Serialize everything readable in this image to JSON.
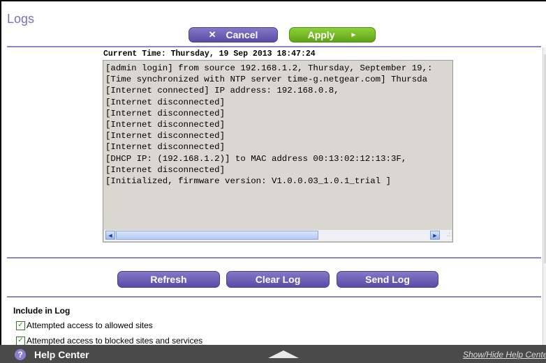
{
  "page": {
    "title": "Logs"
  },
  "toolbar": {
    "cancel_icon": "✕",
    "cancel_label": "Cancel",
    "apply_label": "Apply",
    "apply_arrow": "►"
  },
  "log": {
    "current_time": "Current Time: Thursday, 19 Sep 2013 18:47:24",
    "lines": [
      "[admin login] from source 192.168.1.2, Thursday, September 19,:",
      "[Time synchronized with NTP server time-g.netgear.com] Thursda",
      "[Internet connected] IP address: 192.168.0.8,",
      "[Internet disconnected]",
      "[Internet disconnected]",
      "[Internet disconnected]",
      "[Internet disconnected]",
      "[Internet disconnected]",
      "[DHCP IP: (192.168.1.2)] to MAC address 00:13:02:12:13:3F,",
      "[Internet disconnected]",
      "[Initialized, firmware version: V1.0.0.03_1.0.1_trial ]"
    ],
    "scroll_left_icon": "◄",
    "scroll_right_icon": "►",
    "resize_grip": ".:"
  },
  "actions": {
    "refresh_label": "Refresh",
    "clear_log_label": "Clear Log",
    "send_log_label": "Send Log"
  },
  "include": {
    "heading": "Include in Log",
    "options": [
      {
        "label": "Attempted access to allowed sites",
        "checked": true
      },
      {
        "label": "Attempted access to blocked sites and services",
        "checked": true
      }
    ],
    "check_mark": "✓"
  },
  "footer": {
    "help_icon": "?",
    "help_label": "Help Center",
    "show_hide_label": "Show/Hide Help Center"
  },
  "colors": {
    "title": "#7a6fb8",
    "button_purple": "#5a4ca6",
    "button_green": "#5ea515",
    "footer_bg": "#4a4a4a",
    "divider": "#8e85c6"
  }
}
